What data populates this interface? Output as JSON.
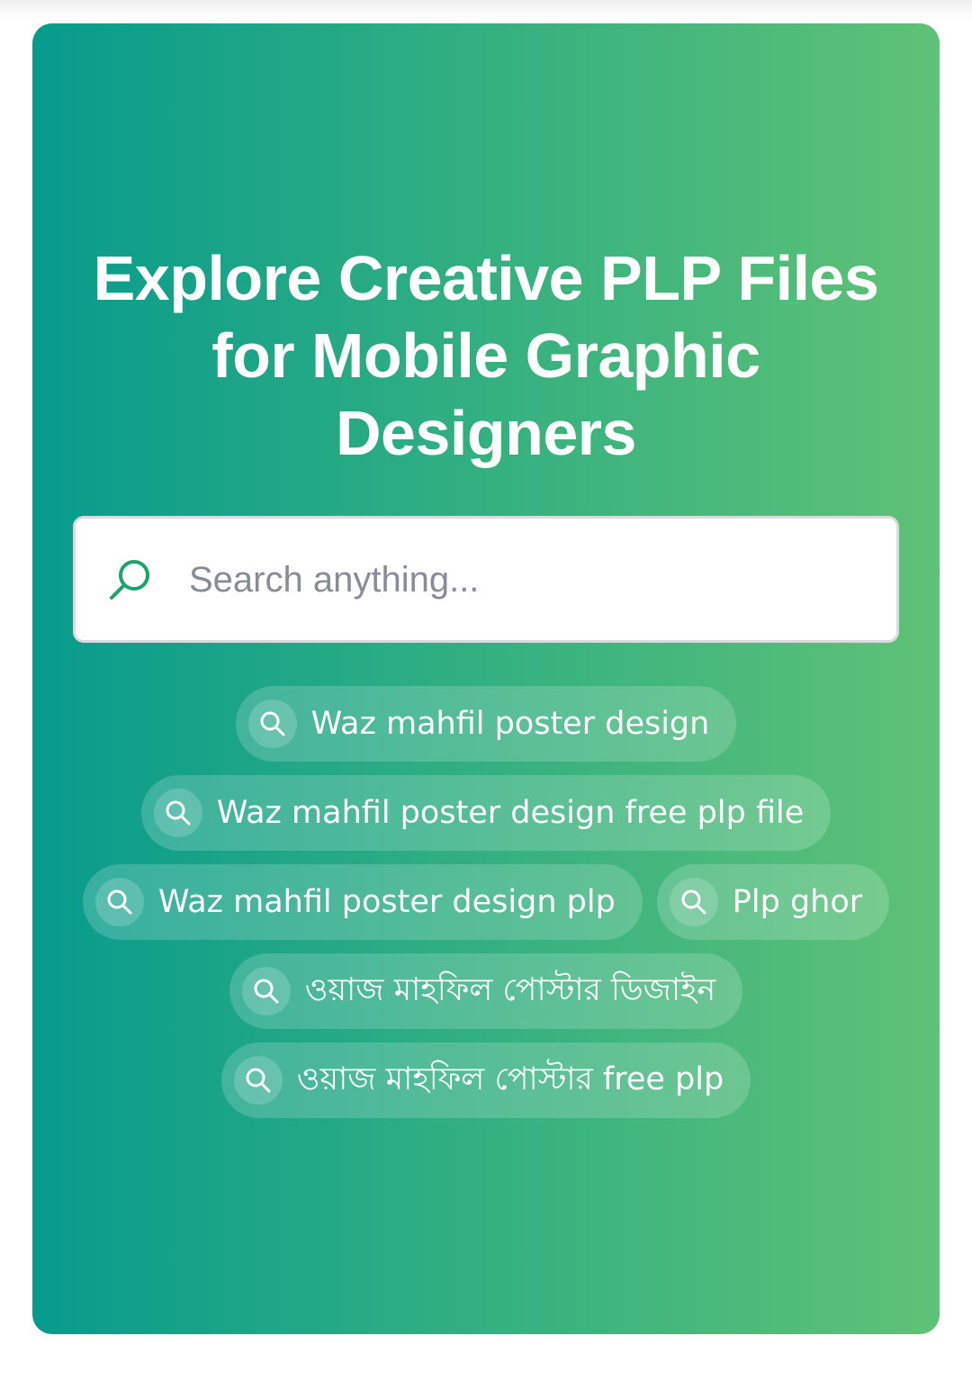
{
  "hero": {
    "title": "Explore Creative PLP Files for Mobile Graphic Designers",
    "gradient_start": "#079b8d",
    "gradient_end": "#5fc276"
  },
  "search": {
    "placeholder": "Search anything...",
    "value": "",
    "icon": "search-icon",
    "icon_color": "#1aa36b"
  },
  "suggestions": [
    {
      "label": "Waz mahfil poster design",
      "icon": "search-icon"
    },
    {
      "label": "Waz mahfil poster design free plp file",
      "icon": "search-icon"
    },
    {
      "label": "Waz mahfil poster design plp",
      "icon": "search-icon"
    },
    {
      "label": "Plp ghor",
      "icon": "search-icon"
    },
    {
      "label": "ওয়াজ মাহফিল পোস্টার ডিজাইন",
      "icon": "search-icon"
    },
    {
      "label": "ওয়াজ মাহফিল পোস্টার free plp",
      "icon": "search-icon"
    }
  ]
}
